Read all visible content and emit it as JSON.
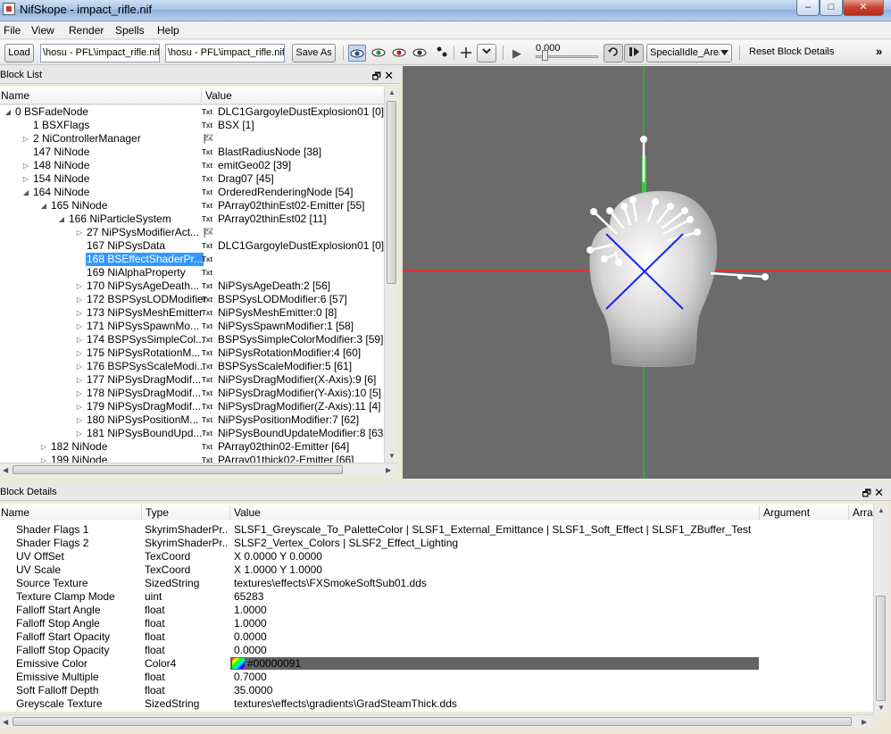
{
  "window": {
    "title": "NifSkope - impact_rifle.nif",
    "min": "–",
    "max": "□",
    "close": "✕"
  },
  "menu": [
    "File",
    "View",
    "Render",
    "Spells",
    "Help"
  ],
  "toolbar": {
    "load_label": "Load",
    "path_field_1": "\\hosu - PFL\\impact_rifle.nif",
    "path_field_2": "\\hosu - PFL\\impact_rifle.nif",
    "save_as_label": "Save As",
    "play_icon": "▶",
    "time_value": "0.000",
    "animation_select": "SpecialIdle_Area",
    "reset_label": "Reset Block Details",
    "overflow": "»"
  },
  "block_list": {
    "header": "Block List",
    "col_name": "Name",
    "col_value": "Value",
    "rows": [
      {
        "name": "0 BSFadeNode",
        "value": "DLC1GargoyleDustExplosion01 [0]",
        "tag": "Txt",
        "arrow": "◢"
      },
      {
        "name": "1 BSXFlags",
        "value": "BSX [1]",
        "tag": "Txt",
        "arrow": ""
      },
      {
        "name": "2 NiControllerManager",
        "value": "",
        "tag": "",
        "arrow": "▷"
      },
      {
        "name": "147 NiNode",
        "value": "BlastRadiusNode [38]",
        "tag": "Txt",
        "arrow": ""
      },
      {
        "name": "148 NiNode",
        "value": "emitGeo02 [39]",
        "tag": "Txt",
        "arrow": "▷"
      },
      {
        "name": "154 NiNode",
        "value": "Drag07 [45]",
        "tag": "Txt",
        "arrow": "▷"
      },
      {
        "name": "164 NiNode",
        "value": "OrderedRenderingNode [54]",
        "tag": "Txt",
        "arrow": "◢"
      },
      {
        "name": "165 NiNode",
        "value": "PArray02thinEst02-Emitter [55]",
        "tag": "Txt",
        "arrow": "◢"
      },
      {
        "name": "166 NiParticleSystem",
        "value": "PArray02thinEst02 [11]",
        "tag": "Txt",
        "arrow": "◢"
      },
      {
        "name": "27 NiPSysModifierAct...",
        "value": "",
        "tag": "",
        "arrow": "▷"
      },
      {
        "name": "167 NiPSysData",
        "value": "DLC1GargoyleDustExplosion01 [0]",
        "tag": "Txt",
        "arrow": ""
      },
      {
        "name": "168 BSEffectShaderPr...",
        "value": "",
        "tag": "Txt",
        "arrow": ""
      },
      {
        "name": "169 NiAlphaProperty",
        "value": "",
        "tag": "Txt",
        "arrow": ""
      },
      {
        "name": "170 NiPSysAgeDeath...",
        "value": "NiPSysAgeDeath:2 [56]",
        "tag": "Txt",
        "arrow": "▷"
      },
      {
        "name": "172 BSPSysLODModifier",
        "value": "BSPSysLODModifier:6 [57]",
        "tag": "Txt",
        "arrow": "▷"
      },
      {
        "name": "173 NiPSysMeshEmitter",
        "value": "NiPSysMeshEmitter:0 [8]",
        "tag": "Txt",
        "arrow": "▷"
      },
      {
        "name": "171 NiPSysSpawnMo...",
        "value": "NiPSysSpawnModifier:1 [58]",
        "tag": "Txt",
        "arrow": "▷"
      },
      {
        "name": "174 BSPSysSimpleCol...",
        "value": "BSPSysSimpleColorModifier:3 [59]",
        "tag": "Txt",
        "arrow": "▷"
      },
      {
        "name": "175 NiPSysRotationM...",
        "value": "NiPSysRotationModifier:4 [60]",
        "tag": "Txt",
        "arrow": "▷"
      },
      {
        "name": "176 BSPSysScaleModi...",
        "value": "BSPSysScaleModifier:5 [61]",
        "tag": "Txt",
        "arrow": "▷"
      },
      {
        "name": "177 NiPSysDragModif...",
        "value": "NiPSysDragModifier(X-Axis):9 [6]",
        "tag": "Txt",
        "arrow": "▷"
      },
      {
        "name": "178 NiPSysDragModif...",
        "value": "NiPSysDragModifier(Y-Axis):10 [5]",
        "tag": "Txt",
        "arrow": "▷"
      },
      {
        "name": "179 NiPSysDragModif...",
        "value": "NiPSysDragModifier(Z-Axis):11 [4]",
        "tag": "Txt",
        "arrow": "▷"
      },
      {
        "name": "180 NiPSysPositionM...",
        "value": "NiPSysPositionModifier:7 [62]",
        "tag": "Txt",
        "arrow": "▷"
      },
      {
        "name": "181 NiPSysBoundUpd...",
        "value": "NiPSysBoundUpdateModifier:8 [63",
        "tag": "Txt",
        "arrow": "▷"
      },
      {
        "name": "182 NiNode",
        "value": "PArray02thin02-Emitter [64]",
        "tag": "Txt",
        "arrow": "▷"
      },
      {
        "name": "199 NiNode",
        "value": "PArray01thick02-Emitter [66]",
        "tag": "Txt",
        "arrow": "▷"
      }
    ]
  },
  "block_details": {
    "header": "Block Details",
    "col_name": "Name",
    "col_type": "Type",
    "col_value": "Value",
    "col_argument": "Argument",
    "col_array": "Arra",
    "rows": [
      {
        "name": "Shader Flags 1",
        "type": "SkyrimShaderPr...",
        "value": "SLSF1_Greyscale_To_PaletteColor | SLSF1_External_Emittance | SLSF1_Soft_Effect | SLSF1_ZBuffer_Test"
      },
      {
        "name": "Shader Flags 2",
        "type": "SkyrimShaderPr...",
        "value": "SLSF2_Vertex_Colors | SLSF2_Effect_Lighting"
      },
      {
        "name": "UV OffSet",
        "type": "TexCoord",
        "value": "X 0.0000 Y 0.0000"
      },
      {
        "name": "UV Scale",
        "type": "TexCoord",
        "value": "X 1.0000 Y 1.0000"
      },
      {
        "name": "Source Texture",
        "type": "SizedString",
        "value": "textures\\effects\\FXSmokeSoftSub01.dds"
      },
      {
        "name": "Texture Clamp Mode",
        "type": "uint",
        "value": "65283"
      },
      {
        "name": "Falloff Start Angle",
        "type": "float",
        "value": "1.0000"
      },
      {
        "name": "Falloff Stop Angle",
        "type": "float",
        "value": "1.0000"
      },
      {
        "name": "Falloff Start Opacity",
        "type": "float",
        "value": "0.0000"
      },
      {
        "name": "Falloff Stop Opacity",
        "type": "float",
        "value": "0.0000"
      },
      {
        "name": "Emissive Color",
        "type": "Color4",
        "value": "#00000091"
      },
      {
        "name": "Emissive Multiple",
        "type": "float",
        "value": "0.7000"
      },
      {
        "name": "Soft Falloff Depth",
        "type": "float",
        "value": "35.0000"
      },
      {
        "name": "Greyscale Texture",
        "type": "SizedString",
        "value": "textures\\effects\\gradients\\GradSteamThick.dds"
      }
    ]
  },
  "colors": {
    "selection": "#3399ff",
    "viewport_bg": "#6b6b6b",
    "axis_x": "#ff2020",
    "axis_y": "#20c020",
    "gizmo": "#2020ff",
    "emissive_bar": "#636363"
  }
}
